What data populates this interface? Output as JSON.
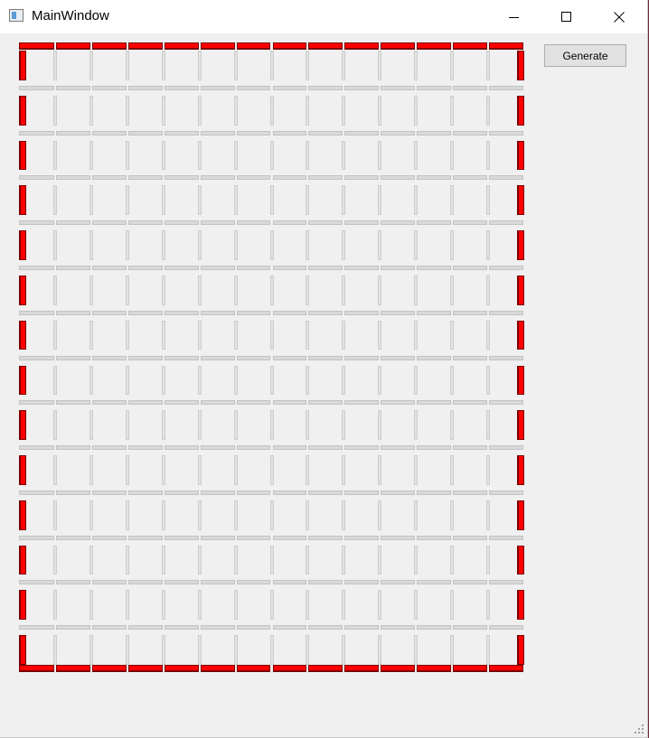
{
  "window": {
    "title": "MainWindow",
    "controls": {
      "minimize": "minimize-icon",
      "maximize": "maximize-icon",
      "close": "close-icon"
    }
  },
  "toolbar": {
    "generate_label": "Generate"
  },
  "maze": {
    "rows": 14,
    "cols": 14,
    "active_wall_color": "#ff0000",
    "inactive_wall_color": "#d9d9d9",
    "active_walls": "outer-border"
  }
}
